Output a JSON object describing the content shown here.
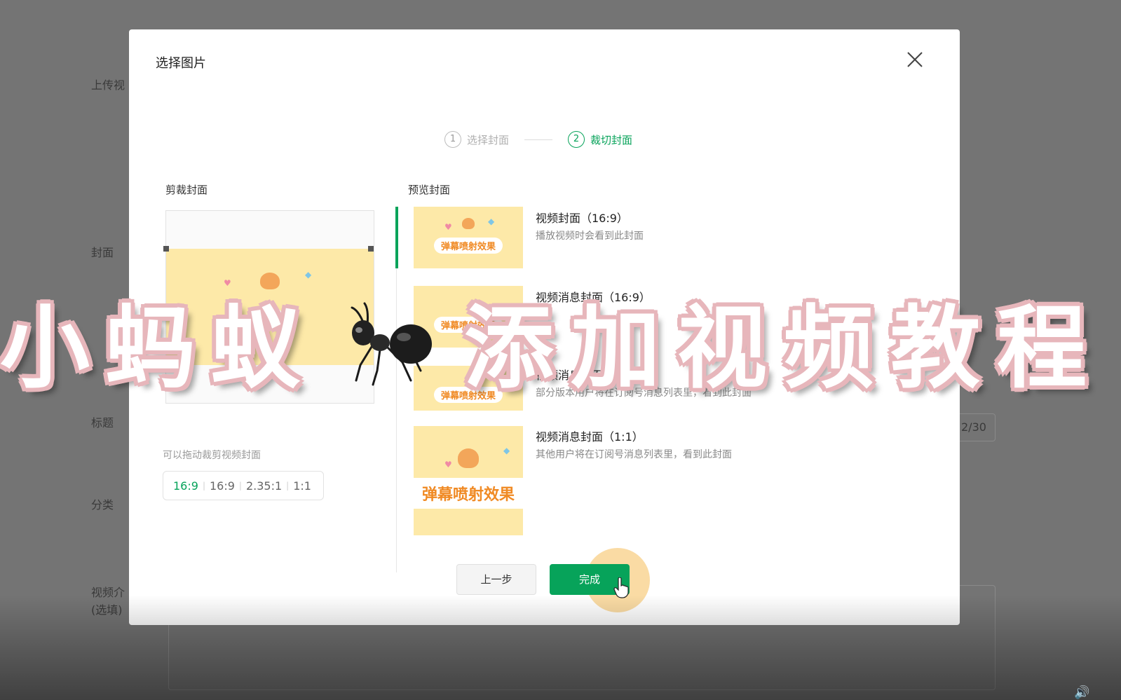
{
  "background": {
    "labels": {
      "upload": "上传视",
      "cover": "封面",
      "title": "标题",
      "category": "分类",
      "intro_line1": "视频介",
      "intro_line2": "(选填)"
    },
    "title_counter": "2/30"
  },
  "modal": {
    "title": "选择图片",
    "steps": [
      {
        "num": "1",
        "label": "选择封面",
        "state": "inactive"
      },
      {
        "num": "2",
        "label": "裁切封面",
        "state": "active"
      }
    ],
    "crop": {
      "label": "剪裁封面",
      "hint": "可以拖动裁剪视频封面",
      "thumb_text": "弹",
      "ratios": [
        "16:9",
        "16:9",
        "2.35:1",
        "1:1"
      ],
      "active_ratio_index": 0
    },
    "preview": {
      "label": "预览封面",
      "thumb_text": "弹幕喷射效果",
      "items": [
        {
          "title": "视频封面（16:9）",
          "desc": "播放视频时会看到此封面"
        },
        {
          "title": "视频消息封面（16:9）",
          "desc": "..."
        },
        {
          "title": "视频消息封面",
          "desc": "部分版本用户将在订阅号消息列表里，看到此封面"
        },
        {
          "title": "视频消息封面（1:1）",
          "desc": "其他用户将在订阅号消息列表里，看到此封面"
        }
      ]
    },
    "buttons": {
      "prev": "上一步",
      "done": "完成"
    }
  },
  "overlay": {
    "caption_left": "小蚂蚁",
    "caption_right": "添加视频教程",
    "stroke_color": "#e7b6bb"
  },
  "colors": {
    "accent": "#07a35a",
    "thumb_bg": "#fde9a8",
    "thumb_text": "#f08a24"
  }
}
